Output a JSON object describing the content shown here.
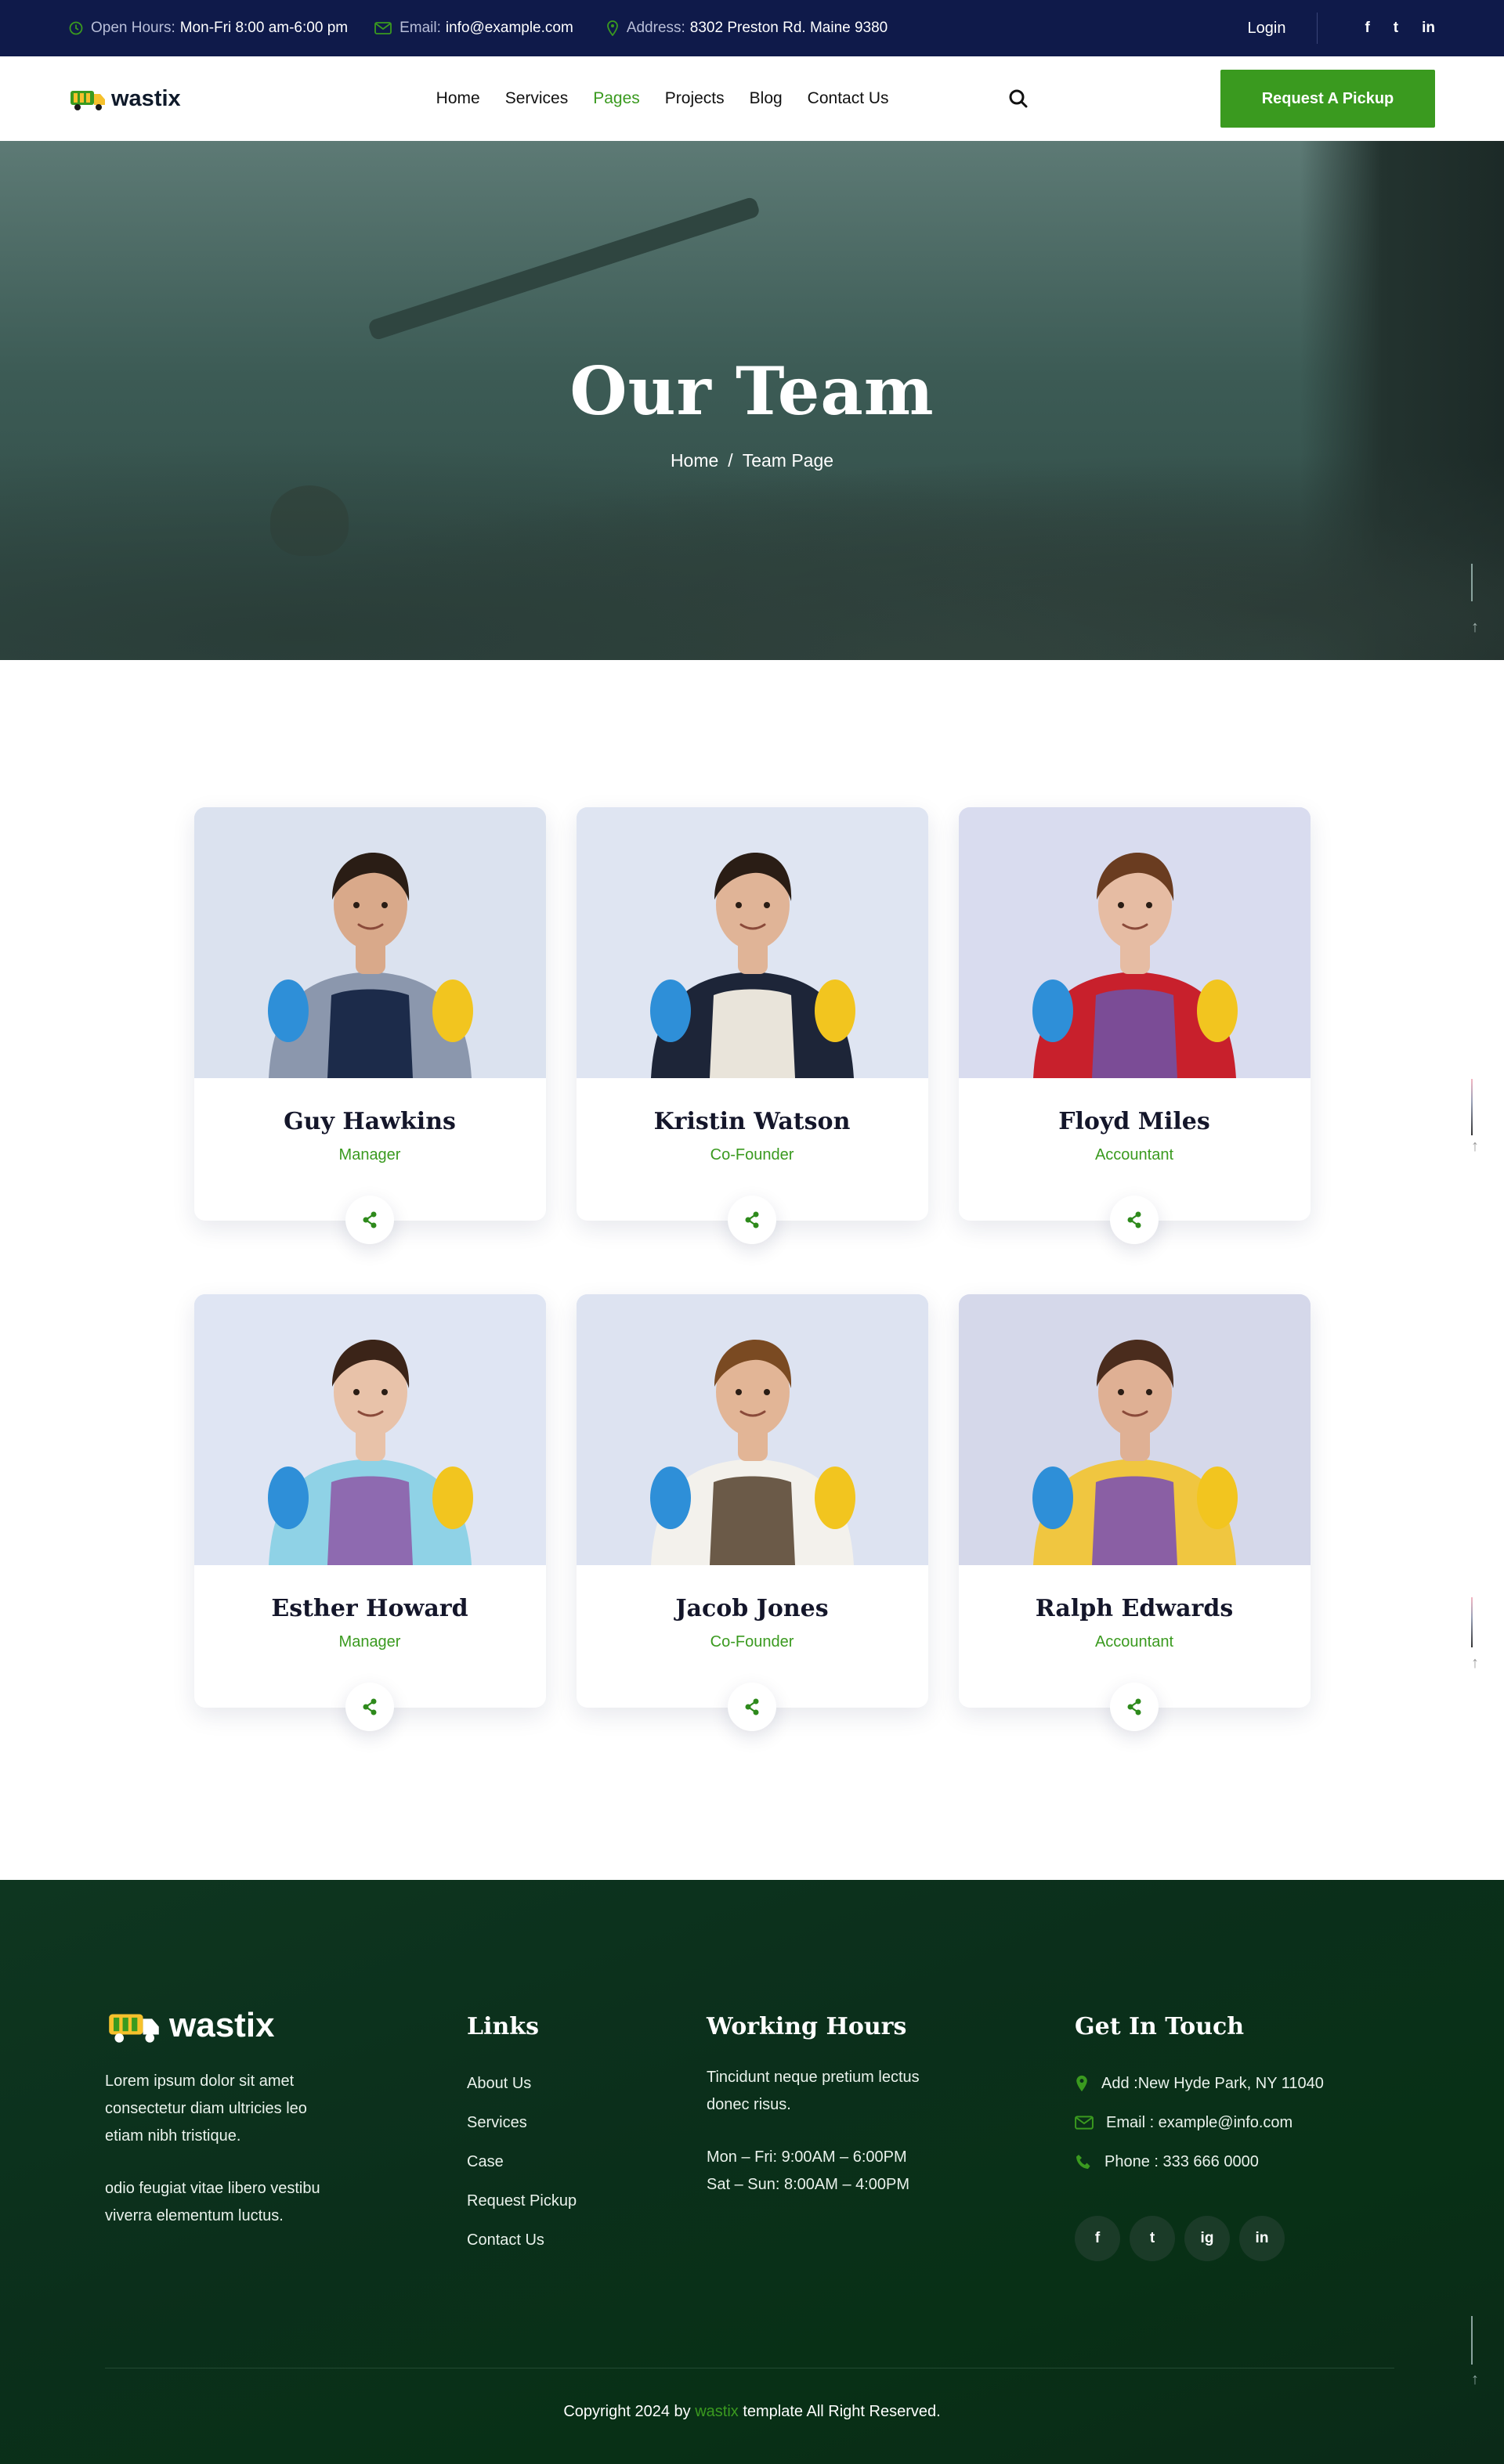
{
  "topbar": {
    "hours_label": "Open Hours:",
    "hours_value": "Mon-Fri 8:00 am-6:00 pm",
    "email_label": "Email:",
    "email_value": "info@example.com",
    "address_label": "Address:",
    "address_value": "8302 Preston Rd. Maine 9380",
    "login": "Login",
    "socials": [
      "f",
      "t",
      "in"
    ]
  },
  "header": {
    "logo_text": "wastix",
    "nav": [
      "Home",
      "Services",
      "Pages",
      "Projects",
      "Blog",
      "Contact Us"
    ],
    "active_nav": "Pages",
    "cta": "Request A Pickup"
  },
  "hero": {
    "title": "Our Team",
    "breadcrumb_home": "Home",
    "breadcrumb_sep": "/",
    "breadcrumb_current": "Team Page"
  },
  "team": [
    {
      "name": "Guy Hawkins",
      "role": "Manager",
      "skin": "#d9a98a",
      "shirt": "#8b97ad",
      "apron": "#1c2b4a",
      "hair": "#2a1d15",
      "bg": "#dbe2ef"
    },
    {
      "name": "Kristin Watson",
      "role": "Co-Founder",
      "skin": "#e0b497",
      "shirt": "#1d2538",
      "apron": "#e9e4da",
      "hair": "#2a1d15",
      "bg": "#dfe5f2"
    },
    {
      "name": "Floyd Miles",
      "role": "Accountant",
      "skin": "#e6bca3",
      "shirt": "#c8202c",
      "apron": "#7b4c96",
      "hair": "#6a3c20",
      "bg": "#d9dcef"
    },
    {
      "name": "Esther Howard",
      "role": "Manager",
      "skin": "#e8c2a9",
      "shirt": "#8fd2e6",
      "apron": "#8e6ab0",
      "hair": "#3b2418",
      "bg": "#dfe5f3"
    },
    {
      "name": "Jacob Jones",
      "role": "Co-Founder",
      "skin": "#e2b596",
      "shirt": "#f3f1ec",
      "apron": "#6b5a48",
      "hair": "#7a4a22",
      "bg": "#dde3f1"
    },
    {
      "name": "Ralph Edwards",
      "role": "Accountant",
      "skin": "#dfb094",
      "shirt": "#f0c640",
      "apron": "#8a5fa4",
      "hair": "#4a2c1d",
      "bg": "#d5d8ea"
    }
  ],
  "footer": {
    "logo_text": "wastix",
    "about_1": "Lorem ipsum dolor sit amet consectetur diam ultricies leo etiam nibh tristique.",
    "about_2": "odio feugiat vitae libero vestibu viverra elementum luctus.",
    "links_title": "Links",
    "links": [
      "About Us",
      "Services",
      "Case",
      "Request Pickup",
      "Contact Us"
    ],
    "hours_title": "Working Hours",
    "hours_desc": "Tincidunt neque pretium lectus donec risus.",
    "hours_1": "Mon – Fri: 9:00AM – 6:00PM",
    "hours_2": "Sat – Sun: 8:00AM – 4:00PM",
    "contact_title": "Get In Touch",
    "address": "Add :New Hyde Park, NY 11040",
    "email": "Email : example@info.com",
    "phone": "Phone : 333 666 0000",
    "socials": [
      "f",
      "t",
      "ig",
      "in"
    ],
    "copyright_pre": "Copyright 2024 by",
    "copyright_brand": "wastix",
    "copyright_post": "template All Right Reserved."
  },
  "colors": {
    "brand_green": "#3a9a1f",
    "topbar_navy": "#0f1a4a",
    "footer_green": "#0b2f1b"
  }
}
